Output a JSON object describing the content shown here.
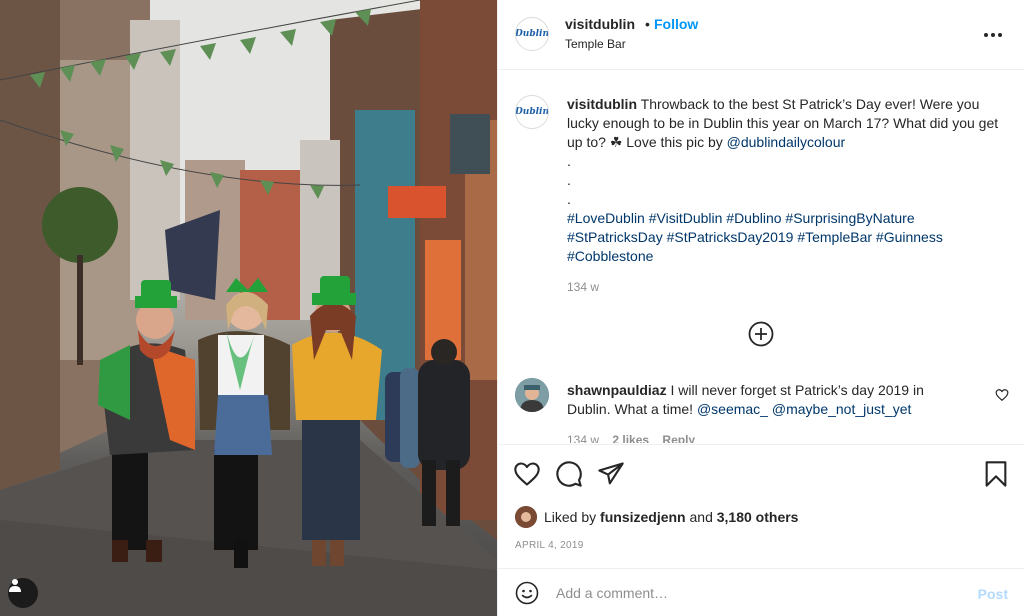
{
  "post": {
    "username": "visitdublin",
    "follow_label": "Follow",
    "separator": "•",
    "location": "Temple Bar",
    "avatar_text": "Dublin",
    "more_icon": "more-horizontal-icon"
  },
  "caption": {
    "username": "visitdublin",
    "text": "Throwback to the best St Patrick’s Day ever! Were you lucky enough to be in Dublin this year on March 17? What did you get up to? ☘ Love this pic by",
    "mention": "@dublindailycolour",
    "dots": [
      ".",
      ".",
      "."
    ],
    "hashtags_line1": "#LoveDublin #VisitDublin #Dublino #SurprisingByNature",
    "hashtags_line2": "#StPatricksDay #StPatricksDay2019 #TempleBar #Guinness",
    "hashtags_line3": "#Cobblestone",
    "time": "134 w"
  },
  "comment": {
    "username": "shawnpauldiaz",
    "text": "I will never forget st Patrick’s day 2019 in Dublin. What a time!",
    "mention1": "@seemac_",
    "mention2": "@maybe_not_just_yet",
    "time": "134 w",
    "likes": "2 likes",
    "reply": "Reply"
  },
  "actions": {
    "liked_prefix": "Liked by",
    "liked_user": "funsizedjenn",
    "and_text": "and",
    "others": "3,180 others",
    "date": "APRIL 4, 2019"
  },
  "add_comment": {
    "placeholder": "Add a comment…",
    "post_label": "Post"
  },
  "colors": {
    "follow": "#0095f6",
    "link": "#00376b",
    "secondary_text": "#8e8e8e",
    "post_disabled": "#b3dbff"
  }
}
